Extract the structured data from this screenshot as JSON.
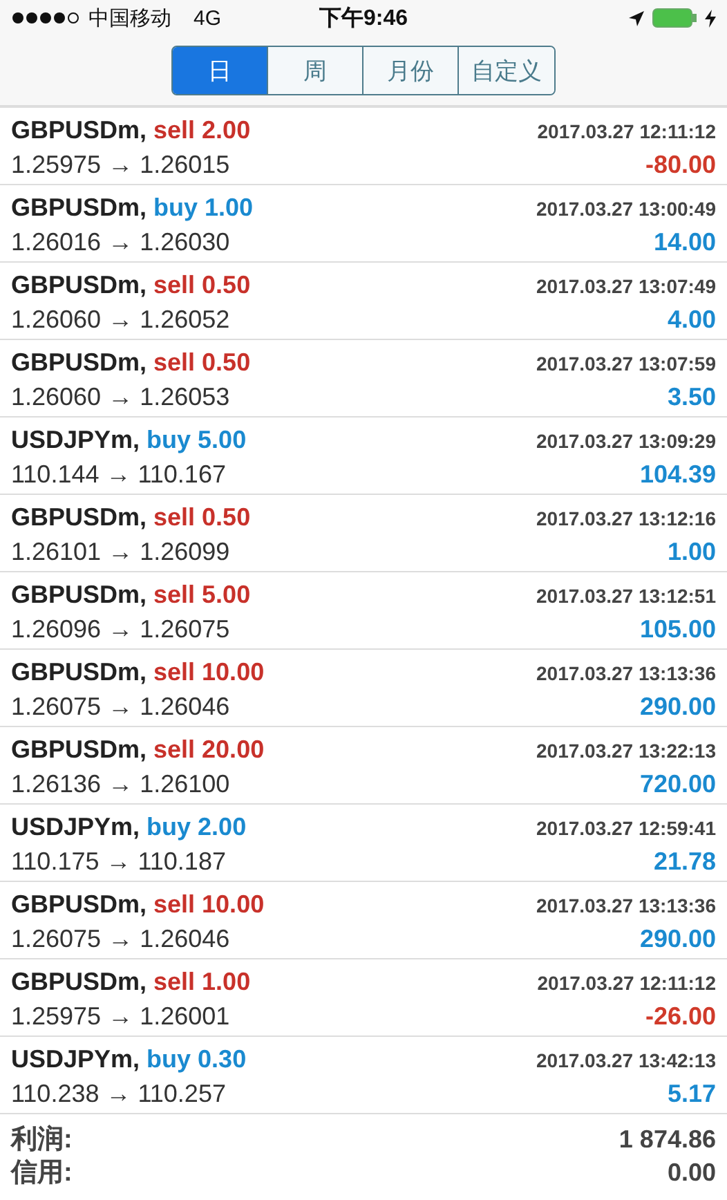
{
  "status_bar": {
    "carrier": "中国移动",
    "network": "4G",
    "time": "下午9:46"
  },
  "tabs": [
    {
      "label": "日",
      "selected": true
    },
    {
      "label": "周",
      "selected": false
    },
    {
      "label": "月份",
      "selected": false
    },
    {
      "label": "自定义",
      "selected": false
    }
  ],
  "deals": [
    {
      "symbol": "GBPUSDm,",
      "order": "sell 2.00",
      "kind": "sell",
      "time": "2017.03.27 12:11:12",
      "prices": "1.25975 → 1.26015",
      "profit": "-80.00",
      "loss": true
    },
    {
      "symbol": "GBPUSDm,",
      "order": "buy 1.00",
      "kind": "buy",
      "time": "2017.03.27 13:00:49",
      "prices": "1.26016 → 1.26030",
      "profit": "14.00",
      "loss": false
    },
    {
      "symbol": "GBPUSDm,",
      "order": "sell 0.50",
      "kind": "sell",
      "time": "2017.03.27 13:07:49",
      "prices": "1.26060 → 1.26052",
      "profit": "4.00",
      "loss": false
    },
    {
      "symbol": "GBPUSDm,",
      "order": "sell 0.50",
      "kind": "sell",
      "time": "2017.03.27 13:07:59",
      "prices": "1.26060 → 1.26053",
      "profit": "3.50",
      "loss": false
    },
    {
      "symbol": "USDJPYm,",
      "order": "buy 5.00",
      "kind": "buy",
      "time": "2017.03.27 13:09:29",
      "prices": "110.144 → 110.167",
      "profit": "104.39",
      "loss": false
    },
    {
      "symbol": "GBPUSDm,",
      "order": "sell 0.50",
      "kind": "sell",
      "time": "2017.03.27 13:12:16",
      "prices": "1.26101 → 1.26099",
      "profit": "1.00",
      "loss": false
    },
    {
      "symbol": "GBPUSDm,",
      "order": "sell 5.00",
      "kind": "sell",
      "time": "2017.03.27 13:12:51",
      "prices": "1.26096 → 1.26075",
      "profit": "105.00",
      "loss": false
    },
    {
      "symbol": "GBPUSDm,",
      "order": "sell 10.00",
      "kind": "sell",
      "time": "2017.03.27 13:13:36",
      "prices": "1.26075 → 1.26046",
      "profit": "290.00",
      "loss": false
    },
    {
      "symbol": "GBPUSDm,",
      "order": "sell 20.00",
      "kind": "sell",
      "time": "2017.03.27 13:22:13",
      "prices": "1.26136 → 1.26100",
      "profit": "720.00",
      "loss": false
    },
    {
      "symbol": "USDJPYm,",
      "order": "buy 2.00",
      "kind": "buy",
      "time": "2017.03.27 12:59:41",
      "prices": "110.175 → 110.187",
      "profit": "21.78",
      "loss": false
    },
    {
      "symbol": "GBPUSDm,",
      "order": "sell 10.00",
      "kind": "sell",
      "time": "2017.03.27 13:13:36",
      "prices": "1.26075 → 1.26046",
      "profit": "290.00",
      "loss": false
    },
    {
      "symbol": "GBPUSDm,",
      "order": "sell 1.00",
      "kind": "sell",
      "time": "2017.03.27 12:11:12",
      "prices": "1.25975 → 1.26001",
      "profit": "-26.00",
      "loss": true
    },
    {
      "symbol": "USDJPYm,",
      "order": "buy 0.30",
      "kind": "buy",
      "time": "2017.03.27 13:42:13",
      "prices": "110.238 → 110.257",
      "profit": "5.17",
      "loss": false
    }
  ],
  "summary": [
    {
      "label": "利润:",
      "value": "1 874.86"
    },
    {
      "label": "信用:",
      "value": "0.00"
    }
  ]
}
